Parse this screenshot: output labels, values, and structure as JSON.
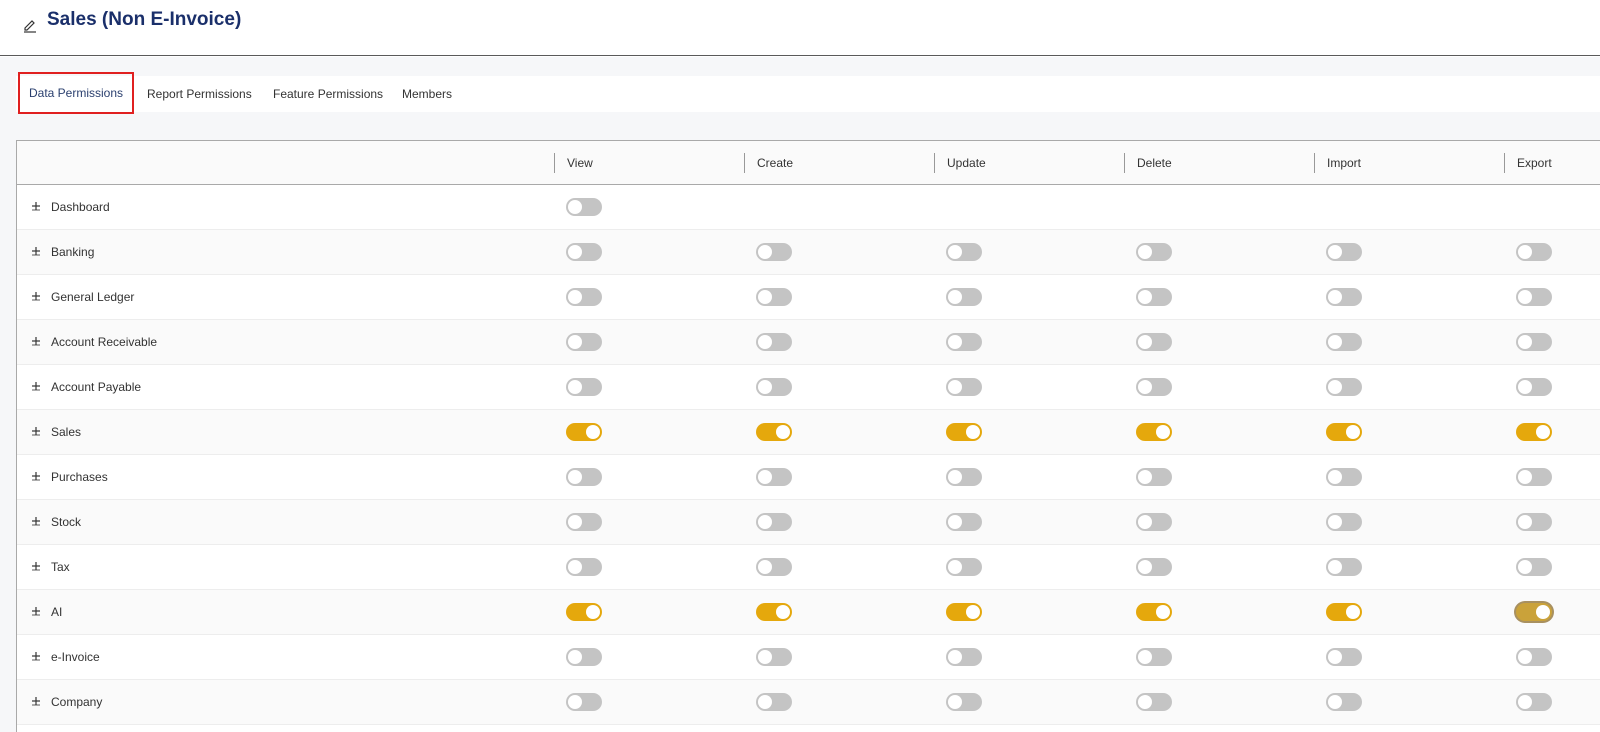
{
  "header": {
    "title": "Sales (Non E-Invoice)",
    "edit_icon": "pencil-icon"
  },
  "tabs": [
    {
      "label": "Data Permissions",
      "active": true
    },
    {
      "label": "Report Permissions",
      "active": false
    },
    {
      "label": "Feature Permissions",
      "active": false
    },
    {
      "label": "Members",
      "active": false
    }
  ],
  "columns": [
    "View",
    "Create",
    "Update",
    "Delete",
    "Import",
    "Export"
  ],
  "toggle_colors": {
    "on": "#e5a80c",
    "off": "#c4c4c4"
  },
  "rows": [
    {
      "label": "Dashboard",
      "toggles": [
        false,
        null,
        null,
        null,
        null,
        null
      ]
    },
    {
      "label": "Banking",
      "toggles": [
        false,
        false,
        false,
        false,
        false,
        false
      ]
    },
    {
      "label": "General Ledger",
      "toggles": [
        false,
        false,
        false,
        false,
        false,
        false
      ]
    },
    {
      "label": "Account Receivable",
      "toggles": [
        false,
        false,
        false,
        false,
        false,
        false
      ]
    },
    {
      "label": "Account Payable",
      "toggles": [
        false,
        false,
        false,
        false,
        false,
        false
      ]
    },
    {
      "label": "Sales",
      "toggles": [
        true,
        true,
        true,
        true,
        true,
        true
      ]
    },
    {
      "label": "Purchases",
      "toggles": [
        false,
        false,
        false,
        false,
        false,
        false
      ]
    },
    {
      "label": "Stock",
      "toggles": [
        false,
        false,
        false,
        false,
        false,
        false
      ]
    },
    {
      "label": "Tax",
      "toggles": [
        false,
        false,
        false,
        false,
        false,
        false
      ]
    },
    {
      "label": "AI",
      "toggles": [
        true,
        true,
        true,
        true,
        true,
        true
      ]
    },
    {
      "label": "e-Invoice",
      "toggles": [
        false,
        false,
        false,
        false,
        false,
        false
      ]
    },
    {
      "label": "Company",
      "toggles": [
        false,
        false,
        false,
        false,
        false,
        false
      ]
    }
  ]
}
